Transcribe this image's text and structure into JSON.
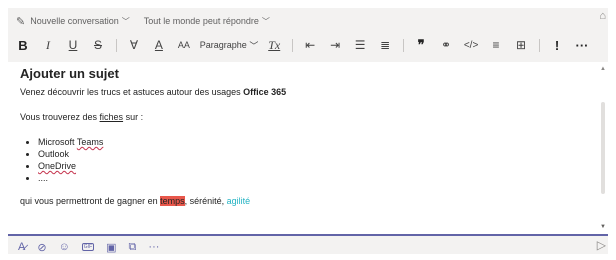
{
  "top_bar": {
    "conversation_type": "Nouvelle conversation",
    "reply_permission": "Tout le monde peut répondre"
  },
  "toolbar": {
    "bold": "B",
    "italic": "I",
    "underline": "U",
    "strike": "S",
    "highlight": "∀",
    "font_color": "A",
    "font_size": "AA",
    "paragraph": "Paragraphe",
    "clear_format": "Tx",
    "quote": "❞",
    "code": "</>",
    "important": "!",
    "more": "···"
  },
  "editor": {
    "subject": "Ajouter un sujet",
    "intro_text": "Venez découvrir les trucs et astuces autour des usages ",
    "intro_bold": "Office 365",
    "find_prefix": "Vous trouverez des ",
    "find_link": "fiches",
    "find_suffix": " sur :",
    "list": [
      {
        "prefix": "Microsoft ",
        "word": "Teams"
      },
      {
        "prefix": "Outlook",
        "word": ""
      },
      {
        "prefix": "",
        "word": "OneDrive"
      },
      {
        "prefix": "....",
        "word": ""
      }
    ],
    "closing_prefix": "qui vous permettront de gagner en ",
    "closing_highlight": "temps",
    "closing_middle": ", sérénité, ",
    "closing_accent": "agilité"
  },
  "bottom_bar": {
    "gif_label": "GIF",
    "more": "···"
  },
  "colors": {
    "accent": "#6264a7",
    "highlight": "#e8574b",
    "teal": "#24b3c3"
  }
}
